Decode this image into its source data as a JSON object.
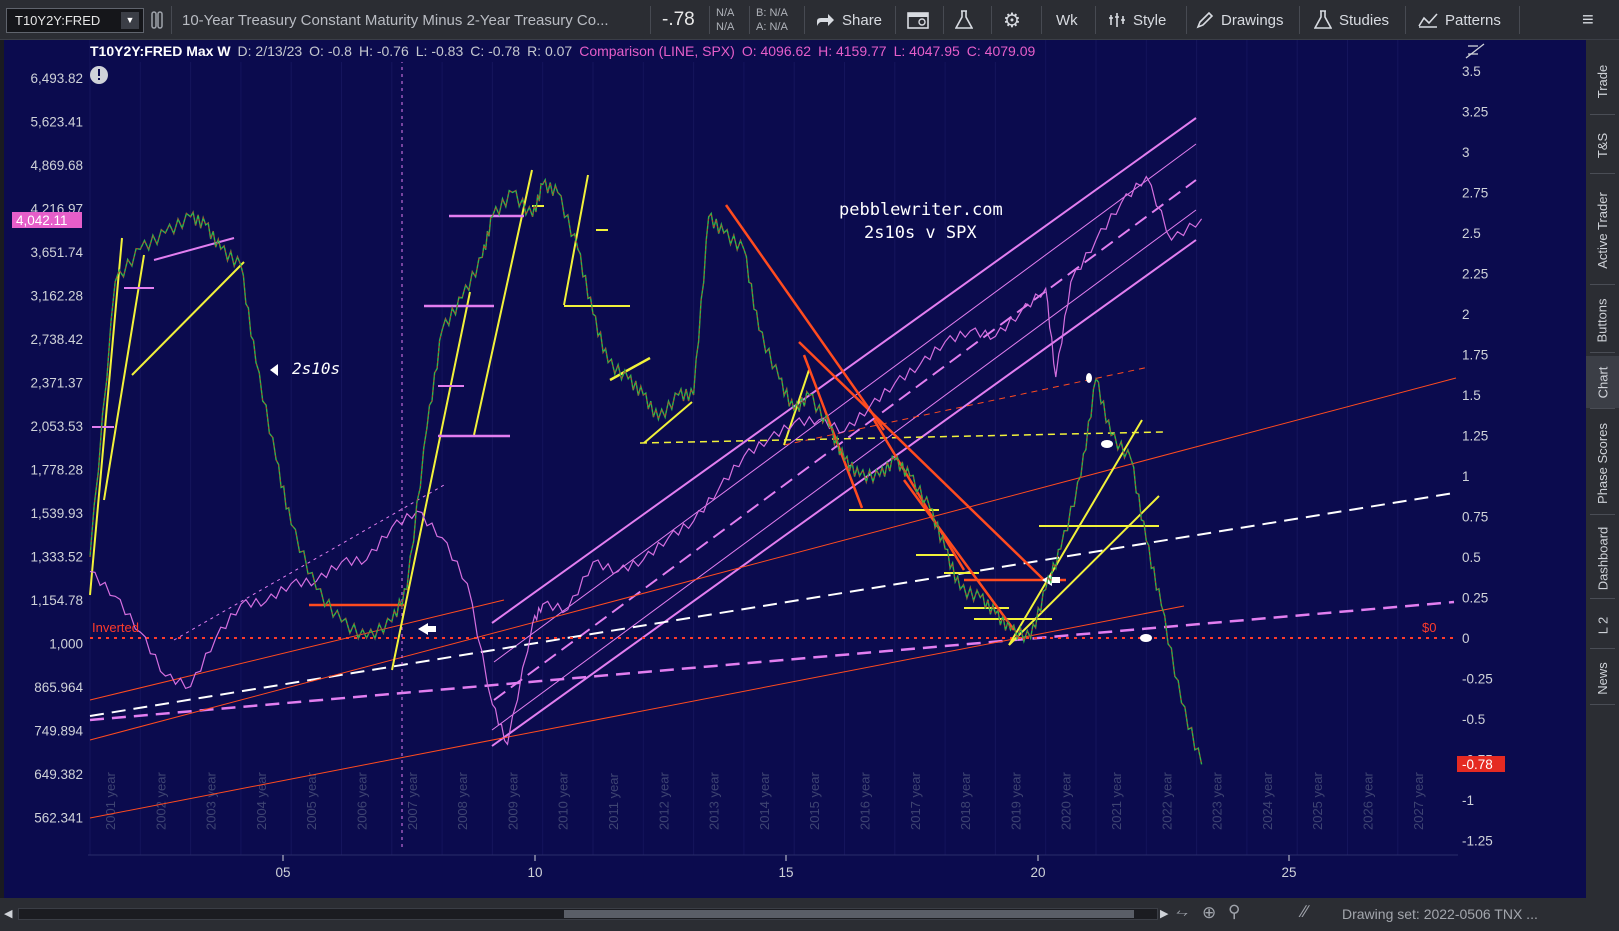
{
  "toolbar": {
    "symbol": "T10Y2Y:FRED",
    "description": "10-Year Treasury Constant Maturity Minus 2-Year Treasury Co...",
    "last": "-.78",
    "nav1": "N/A",
    "nav2": "N/A",
    "bid": "B: N/A",
    "ask": "A: N/A",
    "share": "Share",
    "period": "Wk",
    "style": "Style",
    "drawings": "Drawings",
    "studies": "Studies",
    "patterns": "Patterns"
  },
  "info": {
    "title": "T10Y2Y:FRED Max W",
    "date": "D: 2/13/23",
    "open": "O: -0.8",
    "high": "H: -0.76",
    "low": "L: -0.83",
    "close": "C: -0.78",
    "range": "R: 0.07",
    "comparison": "Comparison (LINE, SPX)",
    "cmp_open": "O: 4096.62",
    "cmp_high": "H: 4159.77",
    "cmp_low": "L: 4047.95",
    "cmp_close": "C: 4079.09"
  },
  "annotations": {
    "site": "pebblewriter.com",
    "subtitle": "2s10s v SPX",
    "series_label": "2s10s",
    "inverted": "Inverted",
    "zero": "$0",
    "spx_marker": "4,042.11",
    "last_marker": "-0.78"
  },
  "left_axis": [
    "6,493.82",
    "5,623.41",
    "4,869.68",
    "4,216.97",
    "3,651.74",
    "3,162.28",
    "2,738.42",
    "2,371.37",
    "2,053.53",
    "1,778.28",
    "1,539.93",
    "1,333.52",
    "1,154.78",
    "1,000",
    "865.964",
    "749.894",
    "649.382",
    "562.341"
  ],
  "right_axis": [
    "3.5",
    "3.25",
    "3",
    "2.75",
    "2.5",
    "2.25",
    "2",
    "1.75",
    "1.5",
    "1.25",
    "1",
    "0.75",
    "0.5",
    "0.25",
    "0",
    "-0.25",
    "-0.5",
    "-0.75",
    "-1",
    "-1.25"
  ],
  "year_labels": [
    "2001 year",
    "2002 year",
    "2003 year",
    "2004 year",
    "2005 year",
    "2006 year",
    "2007 year",
    "2008 year",
    "2009 year",
    "2010 year",
    "2011 year",
    "2012 year",
    "2013 year",
    "2014 year",
    "2015 year",
    "2016 year",
    "2017 year",
    "2018 year",
    "2019 year",
    "2020 year",
    "2021 year",
    "2022 year",
    "2023 year",
    "2024 year",
    "2025 year",
    "2026 year",
    "2027 year"
  ],
  "bottom_axis": [
    "05",
    "10",
    "15",
    "20",
    "25"
  ],
  "side_tabs": [
    "Trade",
    "T&S",
    "Active Trader",
    "Buttons",
    "Chart",
    "Phase Scores",
    "Dashboard",
    "L 2",
    "News"
  ],
  "drawing_set": "Drawing set: 2022-0506 TNX ...",
  "colors": {
    "chart_bg": "#0b0b4e",
    "spx_line": "#d56fe0",
    "candles_up": "#2fb84a",
    "candles_down": "#c23a2a",
    "channel": "#e27ef0",
    "trend_yellow": "#f2f23a",
    "trend_red": "#ff4b1f",
    "zero_line": "#ff3b2a",
    "white_dash": "#ffffff"
  },
  "chart_data": {
    "type": "line",
    "title": "",
    "x_range": [
      2001,
      2028
    ],
    "y_right_range": [
      -1.25,
      3.5
    ],
    "series": [
      {
        "name": "2s10s",
        "x": [
          2001,
          2001.5,
          2002,
          2002.5,
          2003,
          2003.3,
          2003.6,
          2004,
          2004.3,
          2004.7,
          2005,
          2005.5,
          2006,
          2006.5,
          2007,
          2007.3,
          2007.7,
          2008,
          2008.4,
          2008.8,
          2009,
          2009.4,
          2009.8,
          2010,
          2010.3,
          2010.7,
          2011,
          2011.3,
          2011.7,
          2012,
          2012.3,
          2012.7,
          2013,
          2013.3,
          2013.6,
          2014,
          2014.3,
          2014.7,
          2015,
          2015.3,
          2015.7,
          2016,
          2016.3,
          2016.7,
          2017,
          2017.3,
          2017.7,
          2018,
          2018.3,
          2018.7,
          2019,
          2019.3,
          2019.7,
          2020,
          2020.3,
          2020.7,
          2021,
          2021.3,
          2021.7,
          2022,
          2022.3,
          2022.7,
          2023.1
        ],
        "y": [
          0.5,
          2.2,
          2.4,
          2.5,
          2.6,
          2.55,
          2.4,
          2.3,
          1.7,
          1.1,
          0.7,
          0.3,
          0.1,
          0.0,
          0.1,
          0.3,
          1.3,
          1.9,
          2.1,
          2.35,
          2.6,
          2.75,
          2.6,
          2.8,
          2.75,
          2.4,
          2.0,
          1.7,
          1.6,
          1.5,
          1.35,
          1.5,
          1.5,
          2.6,
          2.5,
          2.4,
          1.9,
          1.6,
          1.4,
          1.5,
          1.3,
          1.1,
          1.0,
          1.0,
          1.1,
          1.0,
          0.8,
          0.55,
          0.3,
          0.25,
          0.15,
          0.05,
          0.0,
          0.3,
          0.55,
          1.0,
          1.6,
          1.25,
          1.1,
          0.6,
          0.2,
          -0.4,
          -0.78
        ]
      },
      {
        "name": "SPX",
        "x": [
          2001,
          2001.5,
          2002,
          2002.5,
          2003,
          2003.5,
          2004,
          2004.5,
          2005,
          2005.5,
          2006,
          2006.5,
          2007,
          2007.5,
          2008,
          2008.5,
          2009,
          2009.3,
          2009.8,
          2010,
          2010.5,
          2011,
          2011.5,
          2012,
          2012.5,
          2013,
          2013.5,
          2014,
          2014.5,
          2015,
          2015.5,
          2016,
          2016.5,
          2017,
          2017.5,
          2018,
          2018.5,
          2019,
          2019.5,
          2020,
          2020.2,
          2020.5,
          2021,
          2021.5,
          2022,
          2022.5,
          2023.1
        ],
        "y": [
          1250,
          1150,
          1020,
          880,
          850,
          1000,
          1120,
          1130,
          1200,
          1210,
          1290,
          1300,
          1450,
          1530,
          1400,
          1200,
          800,
          700,
          1050,
          1120,
          1100,
          1290,
          1250,
          1300,
          1400,
          1480,
          1650,
          1840,
          1950,
          2060,
          2080,
          2000,
          2170,
          2350,
          2500,
          2700,
          2800,
          2750,
          2980,
          3230,
          2400,
          3300,
          3800,
          4300,
          4700,
          3800,
          4079
        ]
      }
    ]
  }
}
